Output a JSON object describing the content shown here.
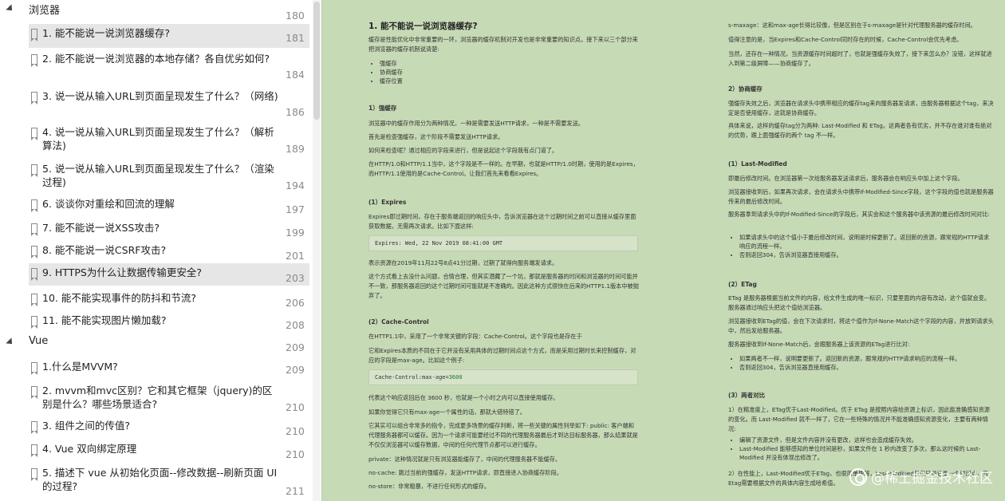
{
  "toc": {
    "sections": [
      {
        "title": "浏览器",
        "page": "180"
      },
      {
        "title": "Vue",
        "page": "209"
      }
    ],
    "items": [
      {
        "title": "1. 能不能说一说浏览器缓存?",
        "page": "181"
      },
      {
        "title": "2. 能不能说一说浏览器的本地存储？各自优劣如何?",
        "page": "184"
      },
      {
        "title": "3. 说一说从输入URL到页面呈现发生了什么？（网络)",
        "page": "186"
      },
      {
        "title": "4. 说一说从输入URL到页面呈现发生了什么？（解析算法)",
        "page": "189"
      },
      {
        "title": "5. 说一说从输入URL到页面呈现发生了什么？（渲染过程)",
        "page": "194"
      },
      {
        "title": "6. 谈谈你对重绘和回流的理解",
        "page": "197"
      },
      {
        "title": "7. 能不能说一说XSS攻击?",
        "page": "199"
      },
      {
        "title": "8. 能不能说一说CSRF攻击?",
        "page": "201"
      },
      {
        "title": "9. HTTPS为什么让数据传输更安全?",
        "page": "203"
      },
      {
        "title": "10. 能不能实现事件的防抖和节流?",
        "page": "206"
      },
      {
        "title": "11. 能不能实现图片懒加载?",
        "page": "208"
      },
      {
        "title": "1.什么是MVVM?",
        "page": "209"
      },
      {
        "title": "2. mvvm和mvc区别？它和其它框架（jquery)的区别是什么？哪些场景适合?",
        "page": "210"
      },
      {
        "title": "3. 组件之间的传值?",
        "page": "210"
      },
      {
        "title": "4. Vue 双向绑定原理",
        "page": "210"
      },
      {
        "title": "5. 描述下 vue 从初始化页面--修改数据--刷新页面 UI 的过程?",
        "page": "211"
      }
    ]
  },
  "doc": {
    "left": {
      "title": "1. 能不能说一说浏览器缓存?",
      "intro": "缓存是性能优化中非常重要的一环，浏览器的缓存机制对开发也是非常重要的知识点。接下来以三个部分来把浏览器的缓存机制说清楚:",
      "intro_list": [
        "强缓存",
        "协商缓存",
        "缓存位置"
      ],
      "s1_title": "1）强缓存",
      "s1_p1": "浏览器中的缓存作用分为两种情况，一种是需要发送HTTP请求，一种是不需要发送。",
      "s1_p2": "首先是检查强缓存，这个阶段不需要发送HTTP请求。",
      "s1_p3": "如何来检查呢？通过相应的字段来进行，但是说起这个字段我有点门道了。",
      "s1_p4": "在HTTP/1.0和HTTP/1.1当中，这个字段是不一样的。在早期，也就是HTTP/1.0时期，使用的是Expires，而HTTP/1.1使用的是Cache-Control。让我们首先来看看Expires。",
      "exp_title": "(1）Expires",
      "exp_p1": "Expires即过期时间，存在于服务端返回的响应头中，告诉浏览器在这个过期时间之前可以直接从缓存里面获取数据，无需再次请求。比如下面这样:",
      "exp_code": "Expires: Wed, 22 Nov 2019 08:41:00 GMT",
      "exp_p2": "表示资源在2019年11月22号8点41分过期，过期了就得向服务端发请求。",
      "exp_p3": "这个方式看上去没什么问题，合情合理，但其实潜藏了一个坑，那就是服务器的时间和浏览器的时间可能并不一致，那服务器返回的这个过期时间可能就是不准确的。因此这种方式很快在后来的HTTP1.1版本中被抛弃了。",
      "cc_title": "(2）Cache-Control",
      "cc_p1": "在HTTP1.1中，采用了一个非常关键的字段：Cache-Control。这个字段也是存在于",
      "cc_p2": "它和Expires本质的不同在于它并没有采用具体的过期时间点这个方式，而是采用过期时长来控制缓存，对应的字段是max-age。比如这个例子:",
      "cc_code_key": "Cache-Control:max-age=",
      "cc_code_val": "3600",
      "cc_p3": "代表这个响应返回后在 3600 秒，也就是一个小时之内可以直接使用缓存。",
      "cc_p4": "如果你觉得它只有max-age一个属性的话，那就大错特错了。",
      "cc_p5": "它其实可以组合非常多的指令，完成更多场景的缓存判断，将一些关键的属性列举如下: public: 客户端和代理服务器都可以缓存。因为一个请求可能要经过不同的代理服务器最后才到达目标服务器，那么结果就是不仅仅浏览器可以缓存数据，中间的任何代理节点都可以进行缓存。",
      "cc_p6": "private：这种情况就是只有浏览器能缓存了，中间的代理服务器不能缓存。",
      "cc_p7": "no-cache: 跳过当前的强缓存，发送HTTP请求，即直接进入协商缓存阶段。",
      "cc_p8": "no-store：非常粗暴，不进行任何形式的缓存。"
    },
    "right": {
      "p1": "s-maxage：这和max-age长得比较像，但是区别在于s-maxage是针对代理服务器的缓存时间。",
      "p2": "值得注意的是，当Expires和Cache-Control同时存在的时候，Cache-Control会优先考虑。",
      "p3": "当然，还存在一种情况，当资源缓存时间超时了，也就是强缓存失效了，接下来怎么办？没错，这样就进入到第二级屏障——协商缓存了。",
      "s2_title": "2）协商缓存",
      "s2_p1": "强缓存失效之后，浏览器在请求头中携带相应的缓存tag来向服务器发请求，由服务器根据这个tag，来决定是否使用缓存，这就是协商缓存。",
      "s2_p2": "具体来说，这样的缓存tag分为两种: Last-Modified 和 ETag。这两者各有优劣，并不存在谁对谁有绝对的优势，跟上面强缓存的两个 tag 不一样。",
      "lm_title": "(1）Last-Modified",
      "lm_p1": "即最后修改时间。在浏览器第一次给服务器发送请求后，服务器会在响应头中加上这个字段。",
      "lm_p2": "浏览器接收到后，如果再次请求，会在请求头中携带If-Modified-Since字段，这个字段的值也就是服务器传来的最后修改时间。",
      "lm_p3": "服务器拿到请求头中的If-Modified-Since的字段后，其实会和这个服务器中该资源的最后修改时间对比:",
      "lm_list": [
        "如果请求头中的这个值小于最后修改时间，说明是时候更新了。返回新的资源，跟常规的HTTP请求响应的流程一样。",
        "否则返回304，告诉浏览器直接用缓存。"
      ],
      "et_title": "(2）ETag",
      "et_p1": "ETag 是服务器根据当前文件的内容，给文件生成的唯一标识，只要里面的内容有改动，这个值就会变。服务器通过响应头把这个值给浏览器。",
      "et_p2": "浏览器接收到ETag的值，会在下次请求时，将这个值作为If-None-Match这个字段的内容，并放到请求头中，然后发给服务器。",
      "et_p3": "服务器接收到If-None-Match后，会跟服务器上该资源的ETag进行比对:",
      "et_list": [
        "如果两者不一样，说明要更新了。返回新的资源，跟常规的HTTP请求响应的流程一样。",
        "否则返回304，告诉浏览器直接用缓存。"
      ],
      "cmp_title": "(3）两者对比",
      "cmp_p1": "1）在精准度上，ETag优于Last-Modified。优于 ETag 是按照内容给资源上标识，因此能准确感知资源的变化。而 Last-Modified 就不一样了，它在一些特殊的情况并不能准确感知资源变化，主要有两种情况:",
      "cmp_list": [
        "编辑了资源文件，但是文件内容并没有更改，这样也会造成缓存失效。",
        "Last-Modified 能够感知的单位时间是秒，如果文件在 1 秒内改变了多次，那么这时候的 Last-Modified 并没有体现出修改了。"
      ],
      "cmp_p2": "2）在性能上，Last-Modified优于ETag，也很简单理解，Last-Modified仅仅只是记录一个时间点，而 Etag需要根据文件的具体内容生成哈希值。"
    }
  },
  "watermark": "@稀土掘金技术社区"
}
